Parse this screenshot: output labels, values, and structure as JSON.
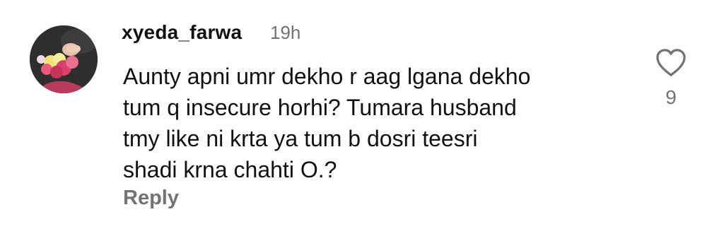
{
  "comment": {
    "username": "xyeda_farwa",
    "timestamp": "19h",
    "text": "Aunty apni umr dekho r aag lgana dekho\ntum q insecure horhi? Tumara husband\ntmy like ni krta ya tum b dosri teesri\nshadi krna chahti O.?",
    "reply_label": "Reply",
    "like_count": "9",
    "like_icon": "heart-outline-icon",
    "avatar": "user-avatar-flowers"
  },
  "colors": {
    "text_primary": "#111111",
    "text_secondary": "#737373",
    "background": "#ffffff"
  }
}
